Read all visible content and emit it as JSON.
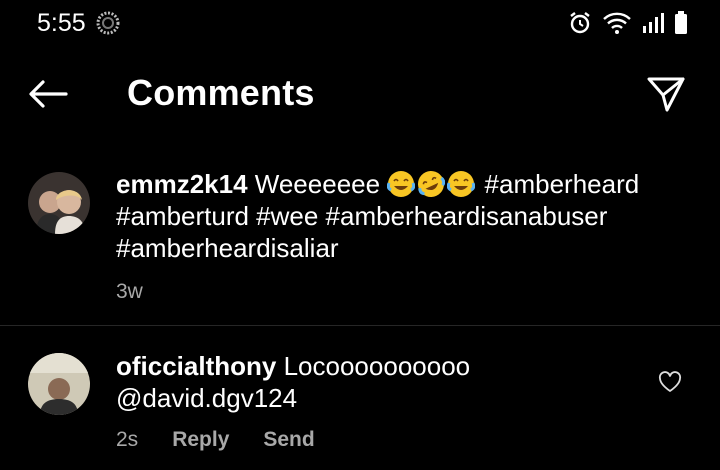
{
  "status_bar": {
    "time": "5:55"
  },
  "header": {
    "title": "Comments"
  },
  "caption": {
    "username": "emmz2k14",
    "text_before": "Weeeeeee",
    "emojis": [
      "face-with-tears-of-joy",
      "rolling-on-the-floor-laughing",
      "face-with-tears-of-joy"
    ],
    "text_after": "#amberheard #amberturd #wee #amberheardisanabuser #amberheardisaliar",
    "age": "3w"
  },
  "comment": {
    "username": "oficcialthony",
    "text": "Locoooooooooo @david.dgv124",
    "age": "2s",
    "reply_label": "Reply",
    "send_label": "Send"
  },
  "colors": {
    "background": "#000000",
    "text": "#ffffff",
    "muted": "#a8a8a8",
    "divider": "#262626"
  }
}
